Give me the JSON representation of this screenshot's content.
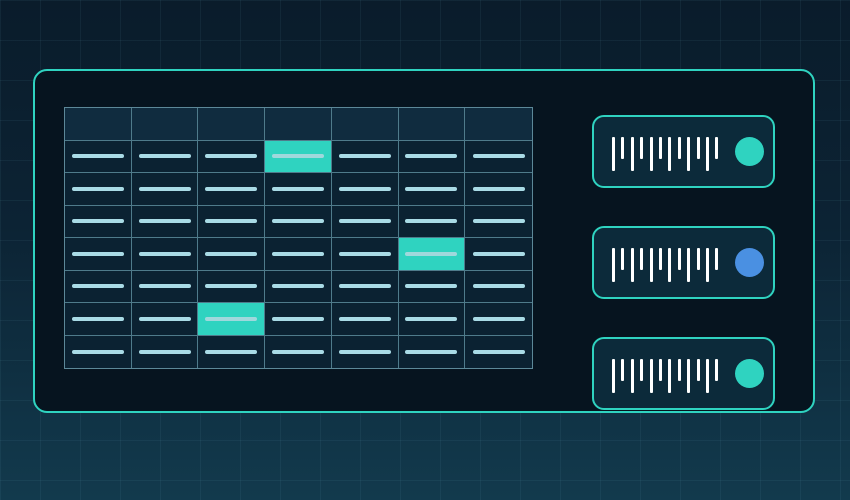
{
  "table": {
    "columns": 7,
    "rows": 7,
    "highlighted_cells": [
      {
        "row": 1,
        "col": 3
      },
      {
        "row": 4,
        "col": 5
      },
      {
        "row": 6,
        "col": 2
      }
    ]
  },
  "status_cards": [
    {
      "indicator_icon": "status-dot-icon",
      "indicator_color": "#2fd3c0"
    },
    {
      "indicator_icon": "status-dot-icon",
      "indicator_color": "#4a90e2"
    },
    {
      "indicator_icon": "status-dot-icon",
      "indicator_color": "#2fd3c0"
    }
  ],
  "colors": {
    "accent": "#2fd3c0",
    "panel": "#06141f",
    "placeholder_text": "#a9dbe6",
    "blue": "#4a90e2"
  }
}
